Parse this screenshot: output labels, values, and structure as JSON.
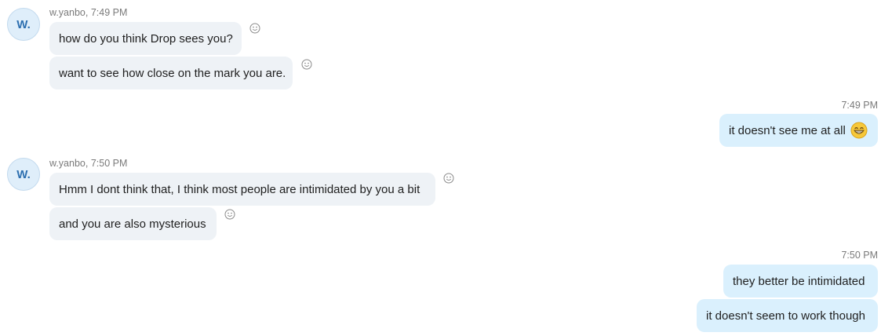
{
  "colors": {
    "incoming_bubble": "#eef2f6",
    "outgoing_bubble": "#daf0fd",
    "avatar_bg": "#dfeefa",
    "avatar_text": "#2d6fb0",
    "meta_text": "#7a7a7a"
  },
  "groups": [
    {
      "direction": "incoming",
      "avatar_initials": "W.",
      "meta": "w.yanbo, 7:49 PM",
      "messages": [
        {
          "text": "how do you think Drop sees you?",
          "reaction_icon": "smiley-icon"
        },
        {
          "text": "want to see how close on the mark you are.",
          "reaction_icon": "smiley-icon"
        }
      ]
    },
    {
      "direction": "outgoing",
      "meta": "7:49 PM",
      "messages": [
        {
          "text": "it doesn't see me at all",
          "emoji": "grinning-face-emoji"
        }
      ]
    },
    {
      "direction": "incoming",
      "avatar_initials": "W.",
      "meta": "w.yanbo, 7:50 PM",
      "messages": [
        {
          "text": "Hmm I dont think that, I think most people are intimidated by you a bit",
          "reaction_icon": "smiley-icon"
        },
        {
          "text": "and you are also mysterious",
          "reaction_icon": "smiley-icon"
        }
      ]
    },
    {
      "direction": "outgoing",
      "meta": "7:50 PM",
      "messages": [
        {
          "text": "they better be intimidated"
        },
        {
          "text": "it doesn't seem to work though"
        }
      ]
    }
  ]
}
